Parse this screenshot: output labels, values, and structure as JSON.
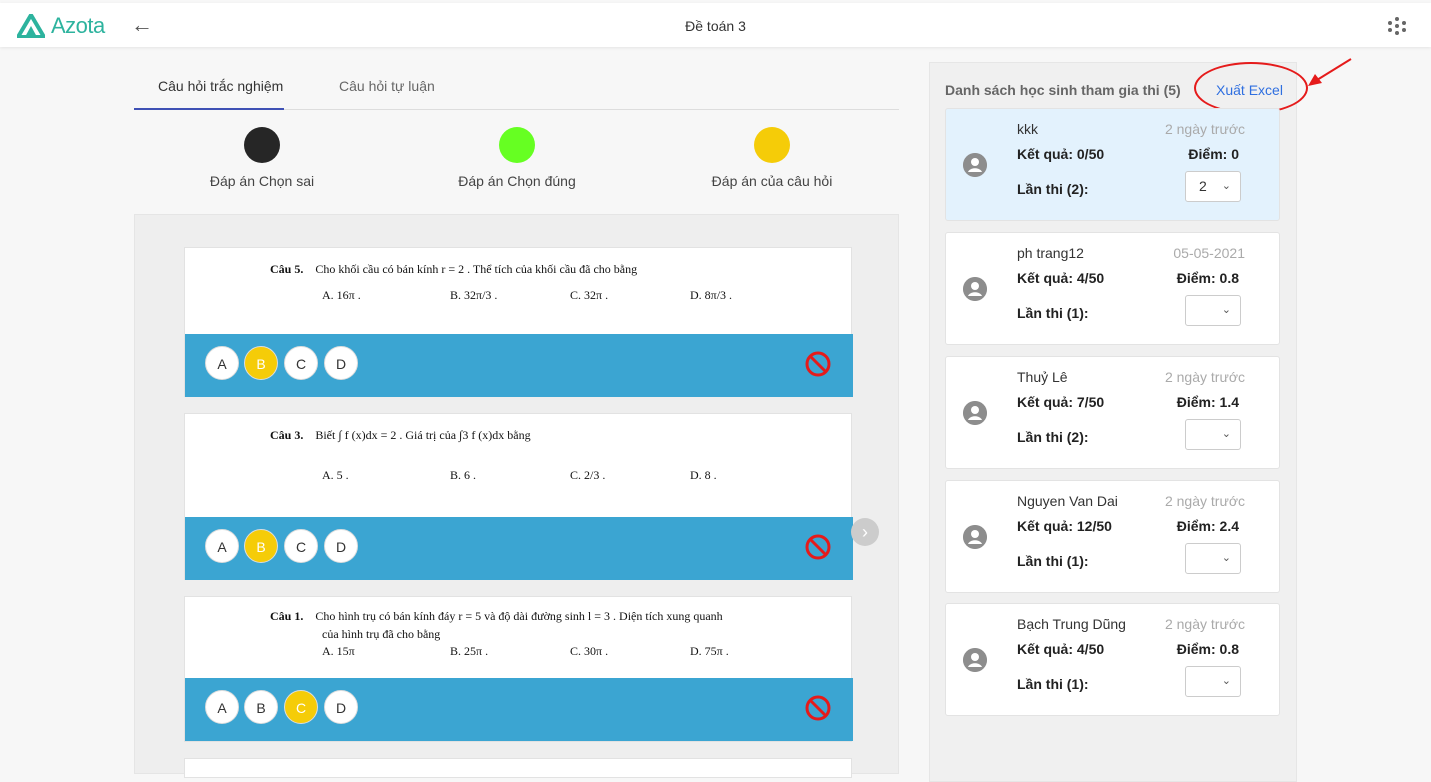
{
  "app": {
    "logo_text": "Azota",
    "title": "Đề toán 3"
  },
  "tabs": [
    {
      "label": "Câu hỏi trắc nghiệm",
      "active": true
    },
    {
      "label": "Câu hỏi tự luận",
      "active": false
    }
  ],
  "legend": [
    {
      "label": "Đáp án Chọn sai",
      "color": "#262626"
    },
    {
      "label": "Đáp án Chọn đúng",
      "color": "#66ff22"
    },
    {
      "label": "Đáp án của câu hỏi",
      "color": "#f5cc08"
    }
  ],
  "questions": [
    {
      "number": "Câu 5.",
      "text": "Cho khối cầu có bán kính  r = 2 . Thể tích của khối cầu đã cho bằng",
      "text2": "",
      "options": [
        "A. 16π .",
        "B. 32π/3 .",
        "C. 32π .",
        "D. 8π/3 ."
      ],
      "answers": [
        "A",
        "B",
        "C",
        "D"
      ],
      "selected": "B"
    },
    {
      "number": "Câu 3.",
      "text": "Biết  ∫ f (x)dx = 2 . Giá trị của  ∫3 f (x)dx  bằng",
      "text2": "",
      "options": [
        "A. 5 .",
        "B. 6 .",
        "C. 2/3 .",
        "D. 8 ."
      ],
      "answers": [
        "A",
        "B",
        "C",
        "D"
      ],
      "selected": "B"
    },
    {
      "number": "Câu 1.",
      "text": "Cho hình trụ có bán kính đáy  r = 5  và độ dài đường sinh  l = 3 . Diện tích xung quanh",
      "text2": "của hình trụ đã cho bằng",
      "options": [
        "A. 15π",
        "B. 25π .",
        "C. 30π .",
        "D. 75π ."
      ],
      "answers": [
        "A",
        "B",
        "C",
        "D"
      ],
      "selected": "C"
    }
  ],
  "sidebar": {
    "title": "Danh sách học sinh tham gia thi (5)",
    "export_label": "Xuất Excel",
    "students": [
      {
        "name": "kkk",
        "date": "2 ngày trước",
        "result": "Kết quả: 0/50",
        "score": "Điểm: 0",
        "attempts": "Lần thi (2):",
        "selected_attempt": "2"
      },
      {
        "name": "ph trang12",
        "date": "05-05-2021",
        "result": "Kết quả: 4/50",
        "score": "Điểm: 0.8",
        "attempts": "Lần thi (1):",
        "selected_attempt": ""
      },
      {
        "name": "Thuỷ Lê",
        "date": "2 ngày trước",
        "result": "Kết quả: 7/50",
        "score": "Điểm: 1.4",
        "attempts": "Lần thi (2):",
        "selected_attempt": ""
      },
      {
        "name": "Nguyen Van Dai",
        "date": "2 ngày trước",
        "result": "Kết quả: 12/50",
        "score": "Điểm: 2.4",
        "attempts": "Lần thi (1):",
        "selected_attempt": ""
      },
      {
        "name": "Bạch Trung Dũng",
        "date": "2 ngày trước",
        "result": "Kết quả: 4/50",
        "score": "Điểm: 0.8",
        "attempts": "Lần thi (1):",
        "selected_attempt": ""
      }
    ]
  }
}
